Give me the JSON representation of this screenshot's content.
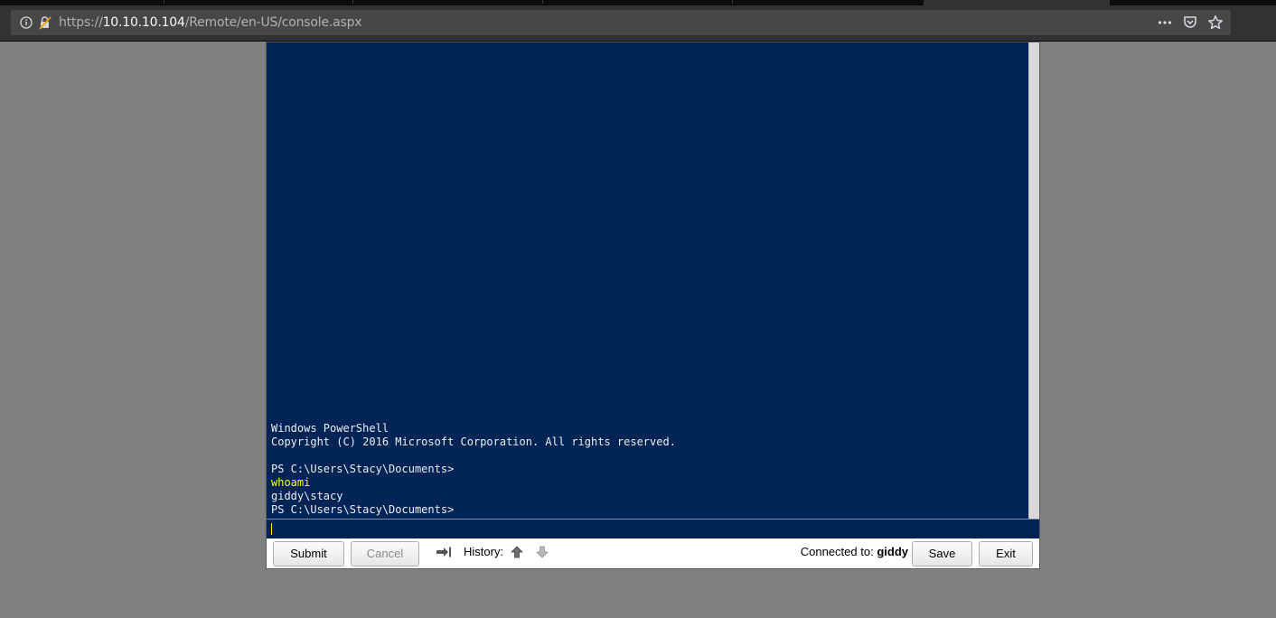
{
  "browser": {
    "url_scheme": "https://",
    "url_host": "10.10.10.104",
    "url_path": "/Remote/en-US/console.aspx"
  },
  "console": {
    "lines": [
      {
        "text": "Windows PowerShell",
        "type": "output"
      },
      {
        "text": "Copyright (C) 2016 Microsoft Corporation. All rights reserved.",
        "type": "output"
      },
      {
        "text": "",
        "type": "output"
      },
      {
        "text": "PS C:\\Users\\Stacy\\Documents>",
        "type": "prompt"
      },
      {
        "text": "whoami",
        "type": "command"
      },
      {
        "text": "giddy\\stacy",
        "type": "output"
      },
      {
        "text": "PS C:\\Users\\Stacy\\Documents>",
        "type": "prompt"
      }
    ],
    "input_value": "",
    "background_color": "#012456",
    "text_color": "#eeedf0",
    "command_color": "#ffff00"
  },
  "toolbar": {
    "submit_label": "Submit",
    "cancel_label": "Cancel",
    "history_label": "History:",
    "connected_label": "Connected to:",
    "connected_host": "giddy",
    "save_label": "Save",
    "exit_label": "Exit"
  },
  "icons": {
    "tab_complete": "tab-arrow-icon",
    "history_up": "arrow-up-icon",
    "history_down": "arrow-down-icon"
  }
}
